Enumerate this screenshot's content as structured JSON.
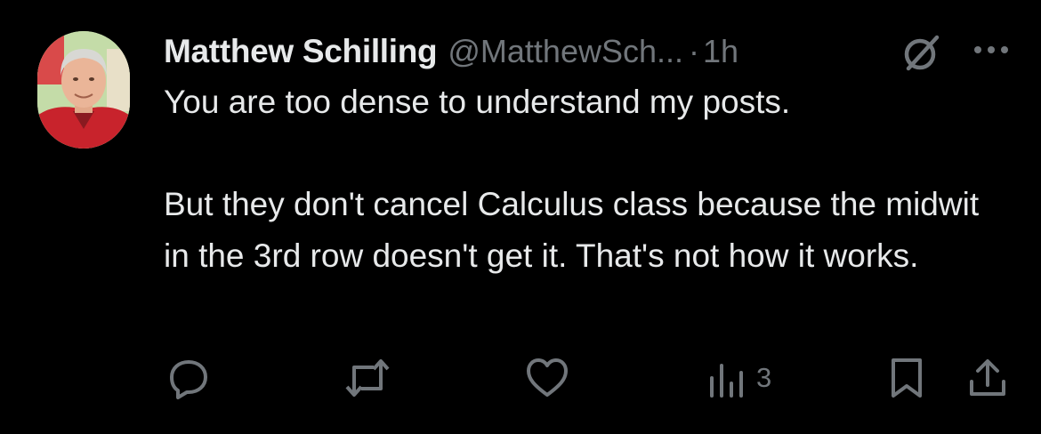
{
  "author": {
    "name": "Matthew Schilling",
    "handle": "@MatthewSch...",
    "separator": "·",
    "time": "1h"
  },
  "post": {
    "paragraph1": "You are too dense to understand my posts.",
    "paragraph2": "But they don't cancel Calculus class because the midwit in the 3rd row doesn't get it. That's not how it works."
  },
  "actions": {
    "views": "3",
    "icons": [
      "reply-icon",
      "repost-icon",
      "like-icon",
      "views-icon",
      "bookmark-icon",
      "share-icon"
    ]
  },
  "colors": {
    "background": "#000000",
    "primary_text": "#e7e9ea",
    "secondary_text": "#71767b"
  }
}
